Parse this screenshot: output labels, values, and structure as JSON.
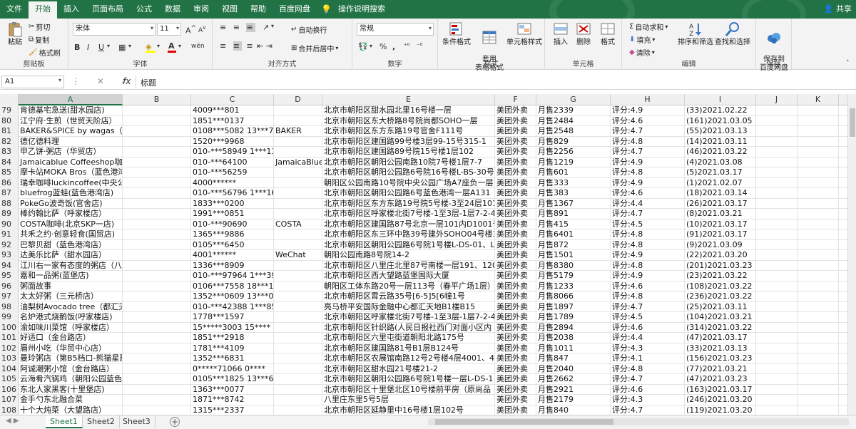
{
  "tabs": [
    "文件",
    "开始",
    "插入",
    "页面布局",
    "公式",
    "数据",
    "审阅",
    "视图",
    "帮助",
    "百度网盘",
    "操作说明搜索"
  ],
  "share_label": "共享",
  "ribbon": {
    "clipboard": {
      "paste": "粘贴",
      "cut": "剪切",
      "copy": "复制",
      "format_painter": "格式刷",
      "label": "剪贴板"
    },
    "font": {
      "name": "宋体",
      "size": "11",
      "bold": "B",
      "italic": "I",
      "underline": "U",
      "grow": "A",
      "shrink": "A",
      "label": "字体",
      "phonetic": "wén"
    },
    "alignment": {
      "wrap": "自动换行",
      "merge": "合并后居中",
      "label": "对齐方式"
    },
    "number": {
      "format": "常规",
      "percent": "%",
      "comma": ",",
      "label": "数字"
    },
    "styles": {
      "conditional": "条件格式",
      "table": "套用\n表格格式",
      "cell_styles": "单元格样式",
      "label": "样式"
    },
    "cells": {
      "insert": "插入",
      "delete": "删除",
      "format": "格式",
      "label": "单元格"
    },
    "editing": {
      "autosum": "自动求和",
      "fill": "填充",
      "clear": "清除",
      "sort": "排序和筛选",
      "find": "查找和选择",
      "label": "编辑"
    },
    "save": {
      "save": "保存到\n百度网盘",
      "label": "保存"
    }
  },
  "formula_bar": {
    "name_box": "A1",
    "fx": "fx",
    "content": "标题",
    "icons": "⋮ ✕ ✓"
  },
  "columns": [
    "A",
    "B",
    "C",
    "D",
    "E",
    "F",
    "G",
    "H",
    "I",
    "J",
    "K"
  ],
  "rows": [
    {
      "n": "79",
      "a": "肯德基宅急送(甜水园店)",
      "b": "",
      "c": "4009***801",
      "d": "",
      "e": "北京市朝阳区甜水园北里16号楼一层",
      "f": "美团外卖",
      "g": "月售2339",
      "h": "评分:4.9",
      "i": "(33)2021.02.22"
    },
    {
      "n": "80",
      "a": "江宁府·生煎（世贸天阶店）",
      "b": "",
      "c": "1851***0137",
      "d": "",
      "e": "北京市朝阳区东大桥路8号院尚都SOHO一层",
      "f": "美团外卖",
      "g": "月售2484",
      "h": "评分:4.6",
      "i": "(161)2021.03.05"
    },
    {
      "n": "81",
      "a": "BAKER&SPICE by wagas（官舍",
      "b": "",
      "c": "0108***5082  13***7",
      "d": "BAKER",
      "e": "北京市朝阳区东方东路19号官舍F111号",
      "f": "美团外卖",
      "g": "月售2548",
      "h": "评分:4.7",
      "i": "(55)2021.03.13"
    },
    {
      "n": "82",
      "a": "德亿德料理",
      "b": "",
      "c": "1520***9968",
      "d": "",
      "e": "北京市朝阳区建国路99号楼3层99-15号315-1",
      "f": "美团外卖",
      "g": "月售829",
      "h": "评分:4.8",
      "i": "(14)2021.03.11"
    },
    {
      "n": "83",
      "a": "甲乙饼·粥店（华贸店）",
      "b": "",
      "c": "010-***58949  1***13",
      "d": "",
      "e": "北京市朝阳区建国路89号院15号楼1层102",
      "f": "美团外卖",
      "g": "月售2256",
      "h": "评分:4.7",
      "i": "(46)2021.03.22"
    },
    {
      "n": "84",
      "a": "Jamaicablue Coffeeshop咖啡",
      "b": "",
      "c": "010-***64100",
      "d": "JamaicaBlue",
      "e": "北京市朝阳区朝阳公园南路10院7号楼1层7-7",
      "f": "美团外卖",
      "g": "月售1219",
      "h": "评分:4.9",
      "i": "(4)2021.03.08"
    },
    {
      "n": "85",
      "a": "摩卡站MOKA Bros（蓝色港湾",
      "b": "",
      "c": "010-***56259",
      "d": "",
      "e": "北京市朝阳区朝阳公园路6号院16号楼L-BS-30号",
      "f": "美团外卖",
      "g": "月售601",
      "h": "评分:4.8",
      "i": "(5)2021.03.17"
    },
    {
      "n": "86",
      "a": "瑞幸咖啡luckincoffee(中央公园",
      "b": "",
      "c": "4000******",
      "d": "",
      "e": "朝阳区公园南路10号院中央公园广场A7座负一层",
      "f": "美团外卖",
      "g": "月售333",
      "h": "评分:4.9",
      "i": "(1)2021.02.07"
    },
    {
      "n": "87",
      "a": "bluefrog蓝蛙(蓝色港湾店)",
      "b": "",
      "c": "010-***56796  1***16",
      "d": "",
      "e": "北京市朝阳区朝阳公园路6号蓝色港湾一层A131",
      "f": "美团外卖",
      "g": "月售383",
      "h": "评分:4.6",
      "i": "(18)2021.03.14"
    },
    {
      "n": "88",
      "a": "PokeGo波奇饭(官舍店)",
      "b": "",
      "c": "1833***0200",
      "d": "",
      "e": "北京市朝阳区东方东路19号院5号楼-3至24层101",
      "f": "美团外卖",
      "g": "月售1367",
      "h": "评分:4.4",
      "i": "(26)2021.03.17"
    },
    {
      "n": "89",
      "a": "棒约翰比萨（呼家楼店）",
      "b": "",
      "c": "1991***0851",
      "d": "",
      "e": "北京市朝阳区呼家楼北街7号楼-1至3层-1层7-2-4",
      "f": "美团外卖",
      "g": "月售891",
      "h": "评分:4.7",
      "i": "(8)2021.03.21"
    },
    {
      "n": "90",
      "a": "COSTA咖啡(北京SKP一店)",
      "b": "",
      "c": "010-***90690",
      "d": "COSTA",
      "e": "北京市朝阳区建国路87号北京一层101内D1001号",
      "f": "美团外卖",
      "g": "月售415",
      "h": "评分:4.5",
      "i": "(10)2021.03.17"
    },
    {
      "n": "91",
      "a": "共禾之约·创意轻食(国贸店)",
      "b": "",
      "c": "1365***9886",
      "d": "",
      "e": "北京市朝阳区东三环中路39号建外SOHO04号楼3",
      "f": "美团外卖",
      "g": "月售6401",
      "h": "评分:4.8",
      "i": "(91)2021.03.17"
    },
    {
      "n": "92",
      "a": "巴黎贝甜（蓝色港湾店）",
      "b": "",
      "c": "0105***6450",
      "d": "",
      "e": "北京市朝阳区朝阳公园路6号院1号楼L-DS-01、L",
      "f": "美团外卖",
      "g": "月售872",
      "h": "评分:4.8",
      "i": "(9)2021.03.09"
    },
    {
      "n": "93",
      "a": "达美乐比萨（甜水园店）",
      "b": "",
      "c": "4001******",
      "d": "WeChat",
      "e": "朝阳公园南路8号院14-2",
      "f": "美团外卖",
      "g": "月售1501",
      "h": "评分:4.9",
      "i": "(22)2021.03.20"
    },
    {
      "n": "94",
      "a": "江川右一家有态度的粥店（八",
      "b": "",
      "c": "1336***8909",
      "d": "",
      "e": "北京市朝阳区八里庄北里87号南楼一层191、120",
      "f": "美团外卖",
      "g": "月售8380",
      "h": "评分:4.8",
      "i": "(201)2021.03.23"
    },
    {
      "n": "95",
      "a": "嘉和一品粥(蓝堡店)",
      "b": "",
      "c": "010-***97964  1***39",
      "d": "",
      "e": "北京市朝阳区西大望路蓝堡国际大厦",
      "f": "美团外卖",
      "g": "月售5179",
      "h": "评分:4.9",
      "i": "(23)2021.03.22"
    },
    {
      "n": "96",
      "a": "粥面故事",
      "b": "",
      "c": "0106***7558  18***1",
      "d": "",
      "e": "朝阳区工体东路20号一层113号（春平广场1层）",
      "f": "美团外卖",
      "g": "月售1233",
      "h": "评分:4.6",
      "i": "(108)2021.03.22"
    },
    {
      "n": "97",
      "a": "太太好粥（三元桥店）",
      "b": "",
      "c": "1352***0609  13***0",
      "d": "",
      "e": "北京市朝阳区霄云路35号[6-5]5[6幢1号",
      "f": "美团外卖",
      "g": "月售8066",
      "h": "评分:4.8",
      "i": "(236)2021.03.22"
    },
    {
      "n": "98",
      "a": "油梨树Avocado tree（都汇天",
      "b": "",
      "c": "010-***42388  1***85",
      "d": "",
      "e": "亮马桥平安国际金融中心都汇天地B1楼B15",
      "f": "美团外卖",
      "g": "月售1897",
      "h": "评分:4.7",
      "i": "(25)2021.03.11"
    },
    {
      "n": "99",
      "a": "名炉港式烧鹅饭(呼家楼店)",
      "b": "",
      "c": "1778***1597",
      "d": "",
      "e": "北京市朝阳区呼家楼北街7号楼-1至3层-1层7-2-4",
      "f": "美团外卖",
      "g": "月售1789",
      "h": "评分:4.5",
      "i": "(104)2021.03.21"
    },
    {
      "n": "100",
      "a": "渝如味川菜馆（呼家楼店）",
      "b": "",
      "c": "15*****3003  15****",
      "d": "",
      "e": "北京市朝阳区针织路(人民日报社西门对面小区内",
      "f": "美团外卖",
      "g": "月售2894",
      "h": "评分:4.6",
      "i": "(314)2021.03.22"
    },
    {
      "n": "101",
      "a": "好适口（金台路店）",
      "b": "",
      "c": "1851***2918",
      "d": "",
      "e": "北京市朝阳区六里屯街道朝阳北路175号",
      "f": "美团外卖",
      "g": "月售2038",
      "h": "评分:4.4",
      "i": "(47)2021.03.17"
    },
    {
      "n": "102",
      "a": "眉州小吃（华贸中心店）",
      "b": "",
      "c": "1781***4109",
      "d": "",
      "e": "北京市朝阳区建国路81号B1层B124号",
      "f": "美团外卖",
      "g": "月售1011",
      "h": "评分:4.3",
      "i": "(33)2021.03.13"
    },
    {
      "n": "103",
      "a": "曼玲粥店（第B5档口-熊猫星厨",
      "b": "",
      "c": "1352***6831",
      "d": "",
      "e": "北京市朝阳区农展馆南路12号2号楼4层4001、40",
      "f": "美团外卖",
      "g": "月售847",
      "h": "评分:4.1",
      "i": "(156)2021.03.23"
    },
    {
      "n": "104",
      "a": "阿诚潮粥小馆（金台路店）",
      "b": "",
      "c": "0*****71066  0****",
      "d": "",
      "e": "北京市朝阳区甜水园21号楼21-2",
      "f": "美团外卖",
      "g": "月售2040",
      "h": "评分:4.8",
      "i": "(77)2021.03.21"
    },
    {
      "n": "105",
      "a": "云海肴汽锅鸡（朝阳公园蓝色",
      "b": "",
      "c": "0105***1825  13***6",
      "d": "",
      "e": "北京市朝阳区朝阳公园路6号院1号楼一层L-DS-1",
      "f": "美团外卖",
      "g": "月售2662",
      "h": "评分:4.7",
      "i": "(47)2021.03.23"
    },
    {
      "n": "106",
      "a": "东北人家黑客(十里堡店)",
      "b": "",
      "c": "1363***0077",
      "d": "",
      "e": "北京市朝阳区十里堡北区10号楼前平房（原尚品",
      "f": "美团外卖",
      "g": "月售2921",
      "h": "评分:4.6",
      "i": "(163)2021.03.17"
    },
    {
      "n": "107",
      "a": "金手勺东北融合菜",
      "b": "",
      "c": "1871***8742",
      "d": "",
      "e": "八里庄东里5号5层",
      "f": "美团外卖",
      "g": "月售2179",
      "h": "评分:4.3",
      "i": "(246)2021.03.20"
    },
    {
      "n": "108",
      "a": "十个大炖菜（大望路店）",
      "b": "",
      "c": "1315***2337",
      "d": "",
      "e": "北京市朝阳区延静里中16号楼1层102号",
      "f": "美团外卖",
      "g": "月售840",
      "h": "评分:4.7",
      "i": "(119)2021.03.20"
    }
  ],
  "sheets": [
    "Sheet1",
    "Sheet2",
    "Sheet3"
  ],
  "add_sheet": "+",
  "nav_arrows": "◀ ▶",
  "colors": {
    "accent": "#217346",
    "ribbon_bg": "#f3f3f3"
  }
}
